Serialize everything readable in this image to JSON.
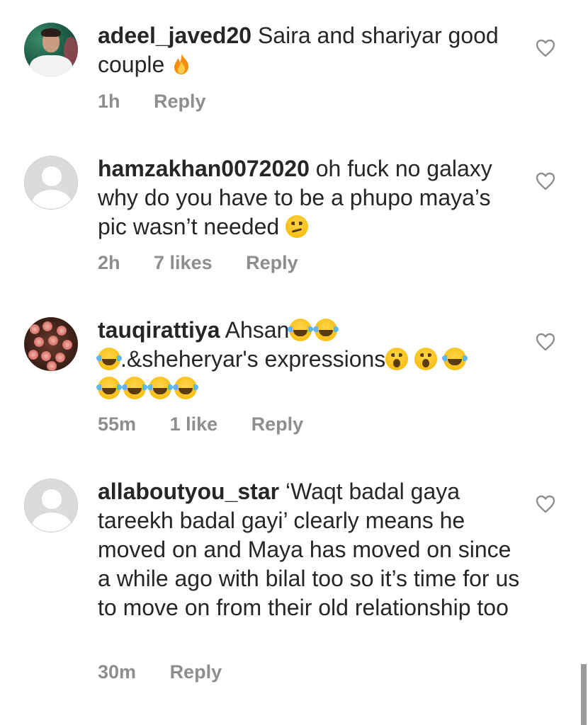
{
  "comments": [
    {
      "username": "adeel_javed20",
      "text": "Saira and shariyar good couple",
      "emojis": [
        "fire"
      ],
      "time": "1h",
      "likes": "",
      "reply": "Reply",
      "avatar": "photo"
    },
    {
      "username": "hamzakhan0072020",
      "text": "oh fuck no galaxy why do you have to be a phupo maya’s pic wasn’t needed",
      "emojis": [
        "confused-face"
      ],
      "time": "2h",
      "likes": "7 likes",
      "reply": "Reply",
      "avatar": "default"
    },
    {
      "username": "tauqirattiya",
      "text_part1": "Ahsan",
      "text_part2": ".&sheheryar's expressions",
      "emojis": [
        "tears-of-joy",
        "tears-of-joy",
        "tears-of-joy",
        "hushed-face",
        "hushed-face",
        "tears-of-joy",
        "tears-of-joy",
        "tears-of-joy",
        "tears-of-joy",
        "tears-of-joy"
      ],
      "time": "55m",
      "likes": "1 like",
      "reply": "Reply",
      "avatar": "photo"
    },
    {
      "username": "allaboutyou_star",
      "text": "‘Waqt badal gaya tareekh badal gayi’ clearly means he moved on and Maya has moved on since a while ago with bilal too so it’s time for us to move on from their old relationship too",
      "time": "30m",
      "likes": "",
      "reply": "Reply",
      "avatar": "default"
    }
  ],
  "icons": {
    "like": "heart-outline-icon"
  },
  "colors": {
    "text": "#262626",
    "meta": "#8e8e8e",
    "heart_stroke": "#8e8e8e"
  }
}
